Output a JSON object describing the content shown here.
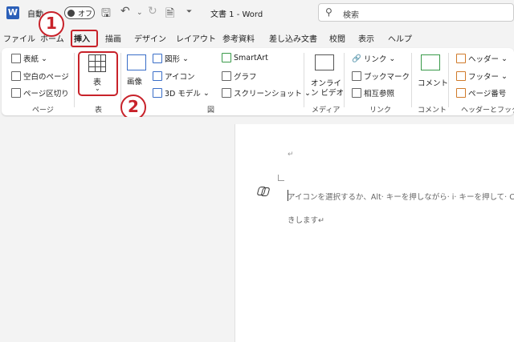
{
  "titlebar": {
    "app_icon": "W",
    "autosave_label": "自動",
    "autosave_state": "オフ",
    "doc_title": "文書 1  -  Word",
    "search_placeholder": "検索",
    "icons": [
      "save-icon",
      "undo-icon",
      "redo-icon",
      "new-doc-icon",
      "customize-icon"
    ]
  },
  "tabs": [
    "ファイル",
    "ホーム",
    "挿入",
    "描画",
    "デザイン",
    "レイアウト",
    "参考資料",
    "差し込み文書",
    "校閲",
    "表示",
    "ヘルプ"
  ],
  "active_tab": "挿入",
  "ribbon": {
    "pages": {
      "items": [
        "表紙",
        "空白のページ",
        "ページ区切り"
      ],
      "group": "ページ"
    },
    "table": {
      "label": "表",
      "group": "表"
    },
    "illustrations": {
      "image": "画像",
      "shapes": "図形",
      "icons": "アイコン",
      "models": "3D モデル",
      "smartart": "SmartArt",
      "chart": "グラフ",
      "screenshot": "スクリーンショット",
      "group": "図"
    },
    "media": {
      "online_video_1": "オンライ",
      "online_video_2": "ン ビデオ",
      "group": "メディア"
    },
    "links": {
      "items": [
        "リンク",
        "ブックマーク",
        "相互参照"
      ],
      "group": "リンク"
    },
    "comments": {
      "label": "コメント",
      "group": "コメント"
    },
    "header_footer": {
      "items": [
        "ヘッダー",
        "フッター",
        "ページ番号"
      ],
      "group": "ヘッダーとフッター"
    }
  },
  "annotations": {
    "step1": "1",
    "step2": "2"
  },
  "document": {
    "para_mark": "↵",
    "hint_line1": "アイコンを選択するか、Alt· キーを押しながら· i· キーを押して· Copi",
    "hint_line2": "きします↵"
  },
  "colors": {
    "accent_red": "#c8222a",
    "word_blue": "#2b5fb8"
  }
}
